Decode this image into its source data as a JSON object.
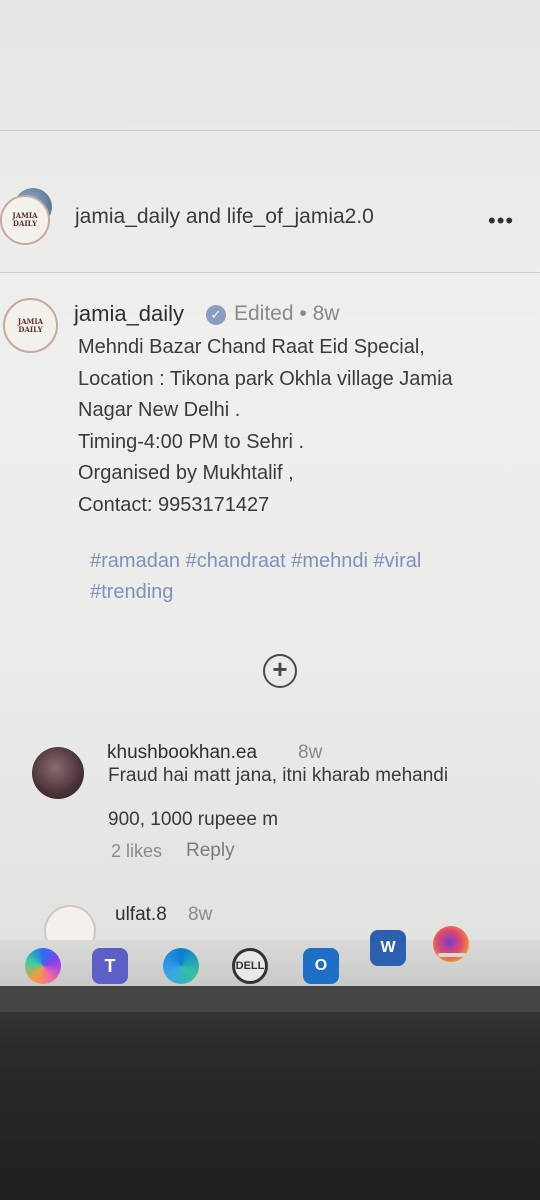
{
  "header": {
    "title": "jamia_daily and life_of_jamia2.0",
    "more_label": "•••",
    "avatar_text": "JAMIA DAILY"
  },
  "post": {
    "username": "jamia_daily",
    "verified_glyph": "✓",
    "meta": "Edited • 8w",
    "caption": "Mehndi Bazar Chand Raat Eid Special,\nLocation : Tikona park Okhla village Jamia\nNagar New Delhi .\nTiming-4:00 PM to Sehri .\nOrganised by Mukhtalif ,\nContact: 9953171427",
    "hashtags": "#ramadan #chandraat #mehndi #viral\n#trending",
    "avatar_text": "JAMIA DAILY",
    "add_glyph": "+"
  },
  "comments": [
    {
      "username": "khushbookhan.ea",
      "age": "8w",
      "text": "Fraud hai matt jana, itni kharab mehandi\n900, 1000 rupeee m",
      "likes": "2 likes",
      "reply": "Reply"
    },
    {
      "username": "ulfat.8",
      "age": "8w"
    }
  ],
  "taskbar": {
    "teams_glyph": "T",
    "dell_label": "DELL",
    "outlook_glyph": "O",
    "word_glyph": "W"
  },
  "icons": [
    "more-icon",
    "verified-icon",
    "add-circle-icon",
    "copilot-icon",
    "teams-icon",
    "edge-icon",
    "dell-icon",
    "outlook-icon",
    "word-icon",
    "firefox-icon"
  ],
  "colors": {
    "hashtag": "#7b93be",
    "muted_text": "#8a8a8a",
    "verified": "#8a9ec0"
  }
}
